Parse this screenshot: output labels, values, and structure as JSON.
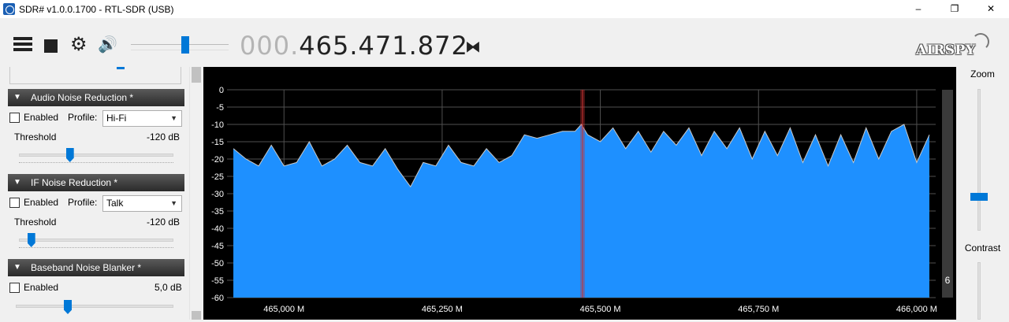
{
  "window": {
    "title": "SDR# v1.0.0.1700 - RTL-SDR (USB)",
    "minimize": "–",
    "maximize": "❐",
    "close": "✕"
  },
  "toolbar": {
    "frequency_prefix": "000.",
    "frequency_main": "465.471.872",
    "logo": "AIRSPY",
    "volume_level": 0.56
  },
  "panels": {
    "audio_nr": {
      "title": "Audio Noise Reduction *",
      "enabled_label": "Enabled",
      "enabled": false,
      "profile_label": "Profile:",
      "profile_value": "Hi-Fi",
      "threshold_label": "Threshold",
      "threshold_value": "-120 dB",
      "slider_level": 0.33
    },
    "if_nr": {
      "title": "IF Noise Reduction *",
      "enabled_label": "Enabled",
      "enabled": false,
      "profile_label": "Profile:",
      "profile_value": "Talk",
      "threshold_label": "Threshold",
      "threshold_value": "-120 dB",
      "slider_level": 0.08
    },
    "baseband_nb": {
      "title": "Baseband Noise Blanker *",
      "enabled_label": "Enabled",
      "enabled": false,
      "value": "5,0 dB",
      "slider_level": 0.33
    }
  },
  "right": {
    "zoom_label": "Zoom",
    "contrast_label": "Contrast",
    "zoom_level": 0.35,
    "level_value": "6"
  },
  "colors": {
    "spectrum_fill": "#1e90ff",
    "spectrum_line": "#c8c8c8",
    "grid": "#505050",
    "tuned_marker": "#c83232",
    "accent": "#0078d7"
  },
  "chart_data": {
    "type": "area",
    "title": "",
    "xlabel": "",
    "ylabel": "",
    "yticks": [
      0,
      -5,
      -10,
      -15,
      -20,
      -25,
      -30,
      -35,
      -40,
      -45,
      -50,
      -55,
      -60
    ],
    "ylim": [
      -60,
      0
    ],
    "xlim": [
      464.91,
      466.03
    ],
    "xticks": [
      465.0,
      465.25,
      465.5,
      465.75,
      466.0
    ],
    "xtick_labels": [
      "465,000 M",
      "465,250 M",
      "465,500 M",
      "465,750 M",
      "466,000 M"
    ],
    "grid": true,
    "tuned_frequency_mhz": 465.471872,
    "series": [
      {
        "x": [
          464.92,
          464.94,
          464.96,
          464.98,
          465.0,
          465.02,
          465.04,
          465.06,
          465.08,
          465.1,
          465.12,
          465.14,
          465.16,
          465.18,
          465.2,
          465.22,
          465.24,
          465.26,
          465.28,
          465.3,
          465.32,
          465.34,
          465.36,
          465.38,
          465.4,
          465.42,
          465.44,
          465.46,
          465.47,
          465.48,
          465.5,
          465.52,
          465.54,
          465.56,
          465.58,
          465.6,
          465.62,
          465.64,
          465.66,
          465.68,
          465.7,
          465.72,
          465.74,
          465.76,
          465.78,
          465.8,
          465.82,
          465.84,
          465.86,
          465.88,
          465.9,
          465.92,
          465.94,
          465.96,
          465.98,
          466.0,
          466.02
        ],
        "values": [
          -17,
          -20,
          -22,
          -16,
          -22,
          -21,
          -15,
          -22,
          -20,
          -16,
          -21,
          -22,
          -17,
          -23,
          -28,
          -21,
          -22,
          -16,
          -21,
          -22,
          -17,
          -21,
          -19,
          -13,
          -14,
          -13,
          -12,
          -12,
          -10,
          -13,
          -15,
          -11,
          -17,
          -12,
          -18,
          -12,
          -16,
          -11,
          -19,
          -12,
          -17,
          -11,
          -20,
          -12,
          -19,
          -11,
          -21,
          -13,
          -22,
          -13,
          -21,
          -11,
          -20,
          -12,
          -10,
          -21,
          -13
        ]
      }
    ]
  }
}
